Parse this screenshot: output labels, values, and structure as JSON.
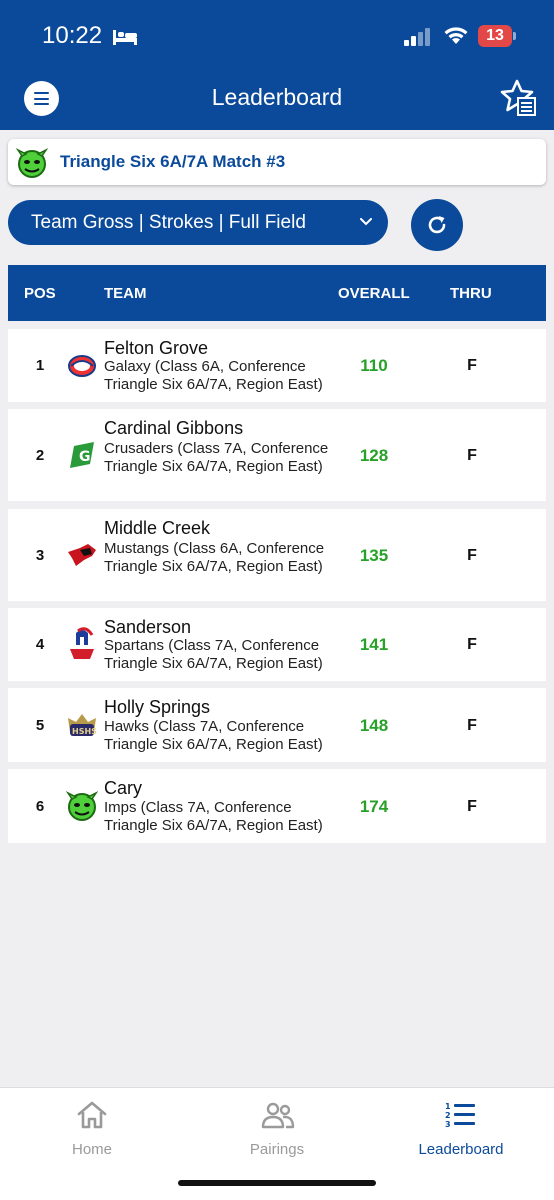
{
  "status_bar": {
    "time": "10:22",
    "battery": "13",
    "icons": [
      "bed-icon",
      "signal-icon",
      "wifi-icon",
      "battery-icon"
    ]
  },
  "header": {
    "title": "Leaderboard",
    "left_icon": "menu-icon",
    "right_icon": "star-list-icon"
  },
  "event": {
    "title": "Triangle Six 6A/7A Match #3",
    "logo_icon": "imp-mascot-logo"
  },
  "filter": {
    "label": "Team Gross | Strokes | Full Field",
    "icon": "chevron-down-icon",
    "refresh_icon": "refresh-icon"
  },
  "table": {
    "columns": {
      "pos": "POS",
      "team": "TEAM",
      "overall": "OVERALL",
      "thru": "THRU"
    },
    "rows": [
      {
        "pos": "1",
        "team": "Felton Grove",
        "desc": "Galaxy (Class 6A, Conference Triangle Six 6A/7A, Region East)",
        "overall": "110",
        "thru": "F",
        "logo": "galaxy-logo"
      },
      {
        "pos": "2",
        "team": "Cardinal Gibbons",
        "desc": "Crusaders (Class 7A, Conference Triangle Six 6A/7A, Region East)",
        "overall": "128",
        "thru": "F",
        "logo": "crusaders-logo"
      },
      {
        "pos": "3",
        "team": "Middle Creek",
        "desc": "Mustangs (Class 6A, Conference Triangle Six 6A/7A, Region East)",
        "overall": "135",
        "thru": "F",
        "logo": "mustangs-logo"
      },
      {
        "pos": "4",
        "team": "Sanderson",
        "desc": "Spartans (Class 7A, Conference Triangle Six 6A/7A, Region East)",
        "overall": "141",
        "thru": "F",
        "logo": "spartans-logo"
      },
      {
        "pos": "5",
        "team": "Holly Springs",
        "desc": "Hawks (Class 7A, Conference Triangle Six 6A/7A, Region East)",
        "overall": "148",
        "thru": "F",
        "logo": "hawks-logo"
      },
      {
        "pos": "6",
        "team": "Cary",
        "desc": "Imps (Class 7A, Conference Triangle Six 6A/7A, Region East)",
        "overall": "174",
        "thru": "F",
        "logo": "imps-logo"
      }
    ]
  },
  "tabbar": {
    "tabs": [
      {
        "label": "Home",
        "icon": "home-icon",
        "active": false
      },
      {
        "label": "Pairings",
        "icon": "people-icon",
        "active": false
      },
      {
        "label": "Leaderboard",
        "icon": "ranked-list-icon",
        "active": true
      }
    ]
  },
  "colors": {
    "brand": "#0b4a9a",
    "score_green": "#27a127",
    "background": "#efeff1",
    "battery_red": "#e24848"
  }
}
